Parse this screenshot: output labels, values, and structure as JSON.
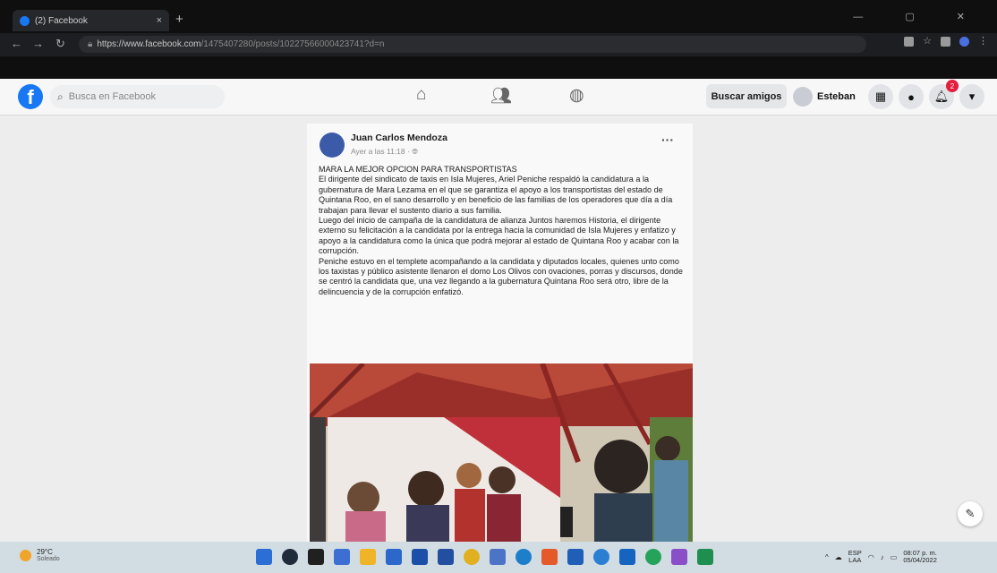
{
  "browser": {
    "tab_title": "(2) Facebook",
    "tab_close": "×",
    "new_tab": "+",
    "url_host": "https://www.facebook.com",
    "url_path": "/1475407280/posts/10227566000423741?d=n",
    "window_controls": "— ▢ ✕"
  },
  "facebook": {
    "logo": "f",
    "search_placeholder": "Busca en Facebook",
    "find_friends": "Buscar amigos",
    "user_name": "Esteban",
    "notification_count": "2"
  },
  "post": {
    "author": "Juan Carlos Mendoza",
    "timestamp": "Ayer a las 11:18 · ",
    "more": "···",
    "paragraphs": [
      "MARA LA MEJOR OPCION PARA TRANSPORTISTAS",
      "El dirigente del sindicato de taxis en Isla Mujeres, Ariel Peniche respaldó la candidatura a la gubernatura de Mara Lezama en el que se garantiza el apoyo a los transportistas del estado de Quintana Roo, en el sano desarrollo y en beneficio de las familias de los operadores que día a día trabajan para llevar el sustento diario a sus familia.",
      "Luego del inicio de campaña de la candidatura de alianza Juntos haremos Historia, el dirigente externo su felicitación a la candidata por la entrega hacia la comunidad de Isla Mujeres y enfatizo y apoyo a la candidatura como la única que podrá mejorar al estado de Quintana Roo y acabar con la corrupción.",
      "Peniche estuvo en el templete acompañando a la candidata y diputados locales, quienes unto como los taxistas y público asistente llenaron el domo Los Olivos con ovaciones, porras y discursos, donde se centró la candidata que, una vez llegando a la gubernatura Quintana Roo será otro, libre de la delincuencia y de la corrupción enfatizó."
    ]
  },
  "taskbar": {
    "temperature": "29°C",
    "weather_desc": "Soleado",
    "lang_top": "ESP",
    "lang_bottom": "LAA",
    "time": "08:07 p. m.",
    "date": "05/04/2022"
  },
  "colors": {
    "fb_blue": "#1877f2",
    "notification_red": "#e41e3f"
  }
}
